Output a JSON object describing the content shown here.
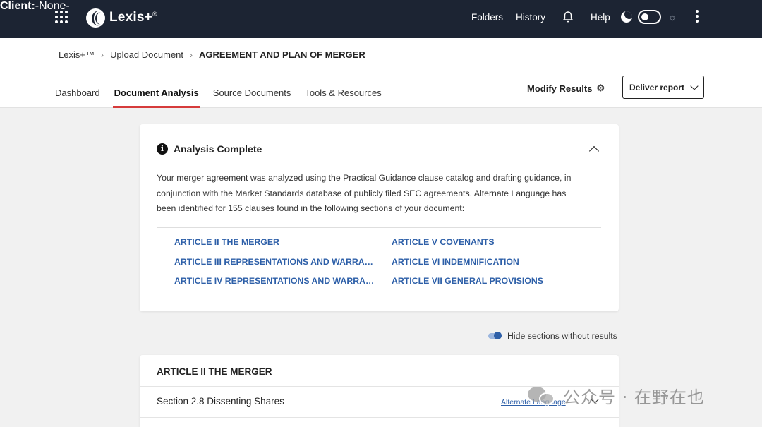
{
  "topbar": {
    "brand": "Lexis+",
    "brand_mark": "®",
    "client_label": "Client:",
    "client_value": "-None-",
    "folders": "Folders",
    "history": "History",
    "help": "Help",
    "icons": {
      "apps": "grid-icon",
      "bell": "bell-icon",
      "dark_mode": "moon-icon",
      "light_mode": "sun-icon",
      "menu": "kebab-icon"
    }
  },
  "breadcrumb": {
    "items": [
      "Lexis+™",
      "Upload Document",
      "AGREEMENT AND PLAN OF MERGER"
    ]
  },
  "tabs": [
    "Dashboard",
    "Document Analysis",
    "Source Documents",
    "Tools & Resources"
  ],
  "active_tab": "Document Analysis",
  "actions": {
    "modify": "Modify Results",
    "deliver": "Deliver report"
  },
  "analysis": {
    "title": "Analysis Complete",
    "description": "Your merger agreement was analyzed using the Practical Guidance clause catalog and drafting guidance, in conjunction with the Market Standards database of publicly filed SEC agreements. Alternate Language has been identified for 155 clauses found in the following sections of your document:",
    "sections": [
      "ARTICLE II THE MERGER",
      "ARTICLE III REPRESENTATIONS AND WARRANTIES",
      "ARTICLE IV REPRESENTATIONS AND WARRANTIES",
      "ARTICLE V COVENANTS",
      "ARTICLE VI INDEMNIFICATION",
      "ARTICLE VII GENERAL PROVISIONS"
    ]
  },
  "filter": {
    "hide_label": "Hide sections without results",
    "enabled": true
  },
  "section": {
    "title": "ARTICLE II THE MERGER",
    "rows": [
      {
        "label": "Section 2.8 Dissenting Shares",
        "link": "Alternate Language"
      }
    ]
  },
  "watermark": {
    "text": "公众号 · 在野在也"
  },
  "colors": {
    "topbar": "#1c2433",
    "link": "#2d5fa8",
    "active_tab_underline": "#d63b3b"
  }
}
